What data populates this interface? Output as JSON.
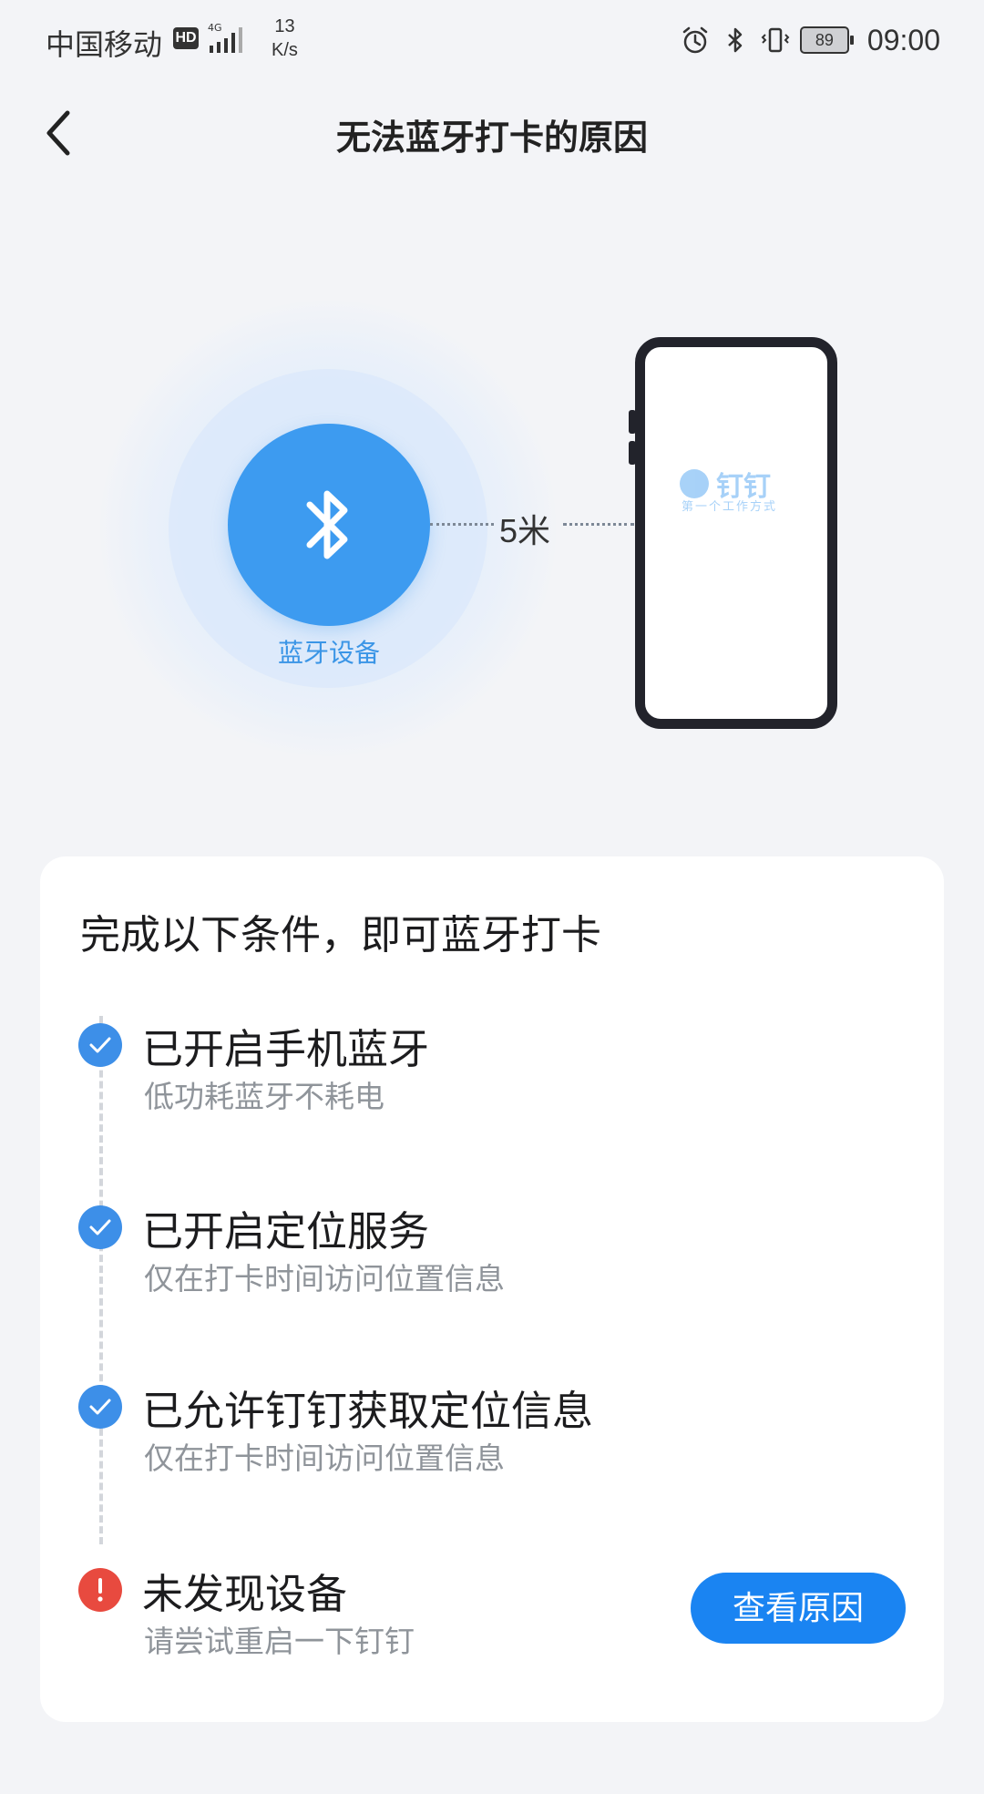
{
  "status_bar": {
    "carrier": "中国移动",
    "hd": "HD",
    "network": "4G",
    "speed_value": "13",
    "speed_unit": "K/s",
    "battery": "89",
    "time": "09:00"
  },
  "header": {
    "title": "无法蓝牙打卡的原因"
  },
  "illustration": {
    "device_label": "蓝牙设备",
    "distance": "5米",
    "phone_logo_text": "钉钉",
    "phone_slogan": "第一个工作方式"
  },
  "card": {
    "title": "完成以下条件，即可蓝牙打卡",
    "steps": [
      {
        "title": "已开启手机蓝牙",
        "subtitle": "低功耗蓝牙不耗电",
        "status": "ok"
      },
      {
        "title": "已开启定位服务",
        "subtitle": "仅在打卡时间访问位置信息",
        "status": "ok"
      },
      {
        "title": "已允许钉钉获取定位信息",
        "subtitle": "仅在打卡时间访问位置信息",
        "status": "ok"
      },
      {
        "title": "未发现设备",
        "subtitle": "请尝试重启一下钉钉",
        "status": "error"
      }
    ],
    "action_button": "查看原因"
  },
  "colors": {
    "accent": "#1a84f2",
    "ok": "#3d8fe8",
    "error": "#e84a3f",
    "background": "#f3f4f7"
  },
  "icons": {
    "back": "chevron-left-icon",
    "bluetooth": "bluetooth-icon",
    "check": "check-icon",
    "error": "exclamation-icon"
  }
}
